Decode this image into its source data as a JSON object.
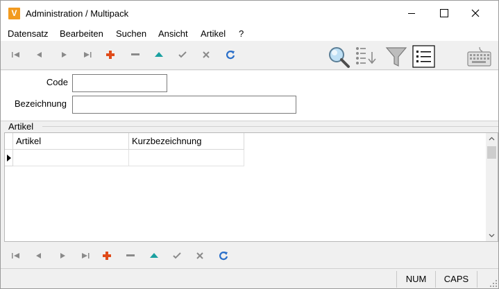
{
  "window": {
    "title": "Administration / Multipack",
    "app_icon_letter": "V",
    "app_icon_color": "#f29a1f"
  },
  "menu": {
    "items": [
      "Datensatz",
      "Bearbeiten",
      "Suchen",
      "Ansicht",
      "Artikel",
      "?"
    ]
  },
  "toolbar": {
    "buttons": [
      "first-record-icon",
      "prev-record-icon",
      "next-record-icon",
      "last-record-icon",
      "add-record-icon",
      "delete-record-icon",
      "save-up-icon",
      "confirm-check-icon",
      "cancel-x-icon",
      "refresh-icon"
    ],
    "tools": [
      "magnifier-icon",
      "sort-list-icon",
      "filter-funnel-icon",
      "list-view-icon",
      "keyboard-icon"
    ]
  },
  "form": {
    "code_label": "Code",
    "code_value": "",
    "bezeichnung_label": "Bezeichnung",
    "bezeichnung_value": ""
  },
  "group": {
    "title": "Artikel"
  },
  "grid": {
    "columns": [
      "Artikel",
      "Kurzbezeichnung"
    ],
    "rows": [
      [
        "",
        ""
      ]
    ]
  },
  "statusbar": {
    "num": "NUM",
    "caps": "CAPS"
  },
  "colors": {
    "add": "#e04b1a",
    "up": "#1aa0a0",
    "refresh": "#2a6fc9",
    "filter": "#8a8a8a"
  }
}
